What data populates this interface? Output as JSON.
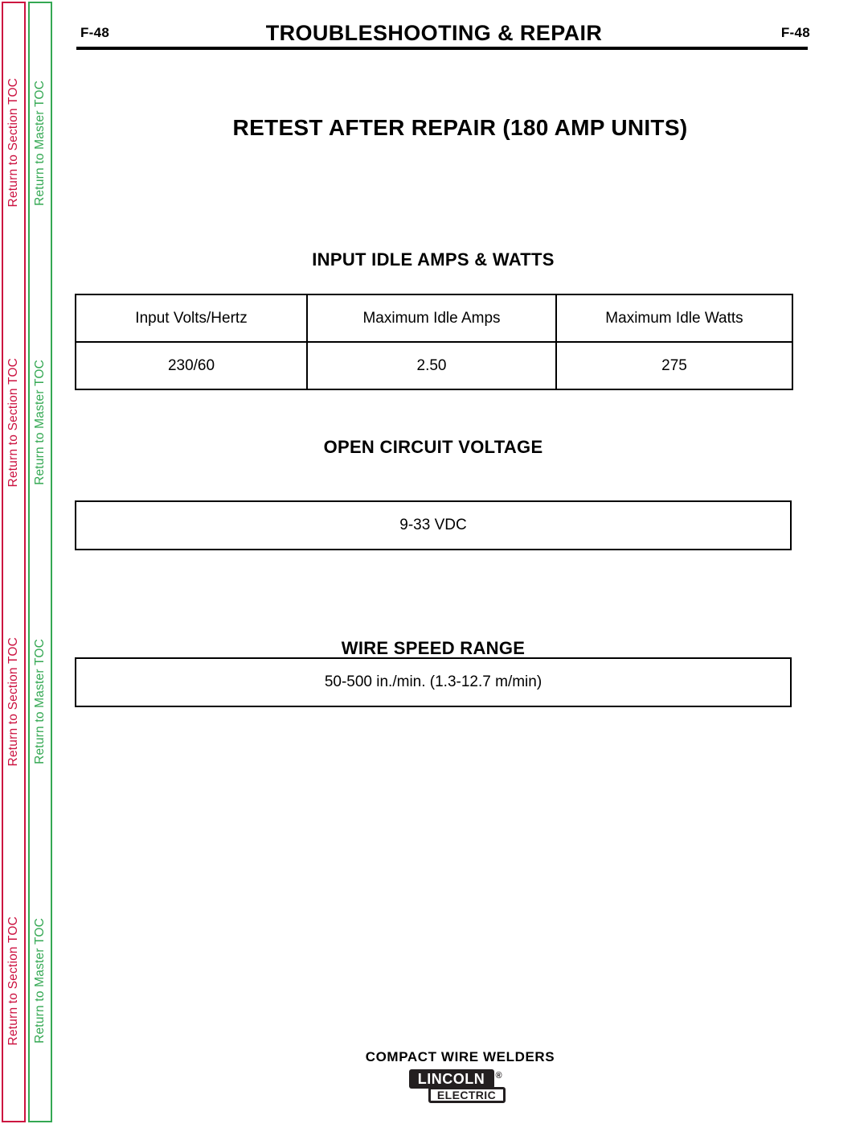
{
  "sidebar": {
    "section_toc": {
      "label": "Return to Section TOC",
      "color": "#cc1240",
      "repeats": 4
    },
    "master_toc": {
      "label": "Return to Master TOC",
      "color": "#34a853",
      "repeats": 4
    }
  },
  "header": {
    "folio_left": "F-48",
    "folio_right": "F-48",
    "running_head": "TROUBLESHOOTING & REPAIR"
  },
  "page_title": "RETEST AFTER REPAIR  (180 AMP UNITS)",
  "sections": {
    "input_idle": {
      "heading": "INPUT IDLE AMPS & WATTS",
      "columns": [
        "Input Volts/Hertz",
        "Maximum Idle Amps",
        "Maximum Idle Watts"
      ],
      "rows": [
        [
          "230/60",
          "2.50",
          "275"
        ]
      ]
    },
    "open_circuit_voltage": {
      "heading": "OPEN CIRCUIT VOLTAGE",
      "value": "9-33 VDC"
    },
    "wire_speed_range": {
      "heading": "WIRE SPEED RANGE",
      "value": "50-500 in./min. (1.3-12.7 m/min)"
    }
  },
  "footer": {
    "title": "COMPACT WIRE WELDERS",
    "brand_primary": "LINCOLN",
    "brand_registered": "®",
    "brand_secondary": "ELECTRIC"
  }
}
